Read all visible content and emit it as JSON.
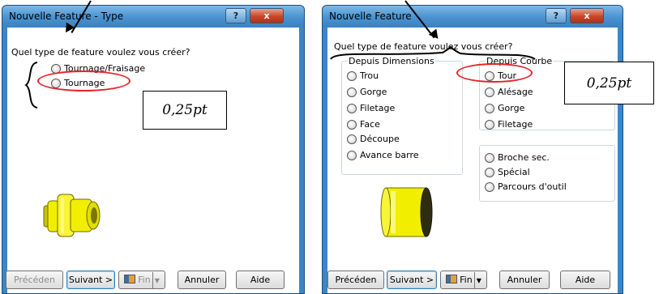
{
  "left_window": {
    "title": "Nouvelle Feature - Type",
    "help_label": "?",
    "close_label": "x",
    "question": "Quel type de feature voulez vous créer?",
    "options": [
      "Tournage/Fraisage",
      "Tournage"
    ],
    "buttons": {
      "prev": "Précéden",
      "next": "Suivant >",
      "finish": "Fin",
      "cancel": "Annuler",
      "help": "Aide"
    }
  },
  "right_window": {
    "title": "Nouvelle Feature",
    "help_label": "?",
    "close_label": "x",
    "question": "Quel type de feature voulez vous créer?",
    "group_dimensions": {
      "label": "Depuis Dimensions",
      "items": [
        "Trou",
        "Gorge",
        "Filetage",
        "Face",
        "Découpe",
        "Avance barre"
      ]
    },
    "group_courbe": {
      "label": "Depuis Courbe",
      "items": [
        "Tour",
        "Alésage",
        "Gorge",
        "Filetage"
      ]
    },
    "group_other": {
      "items": [
        "Broche sec.",
        "Spécial",
        "Parcours d'outil"
      ]
    },
    "buttons": {
      "prev": "Précéden",
      "next": "Suivant >",
      "finish": "Fin",
      "cancel": "Annuler",
      "help": "Aide"
    }
  },
  "annotations": {
    "left_box": "0,25pt",
    "right_box": "0,25pt"
  },
  "colors": {
    "title_bar": "#3a86c6",
    "highlight_oval": "#e5242a",
    "part_yellow": "#f2ee00"
  }
}
